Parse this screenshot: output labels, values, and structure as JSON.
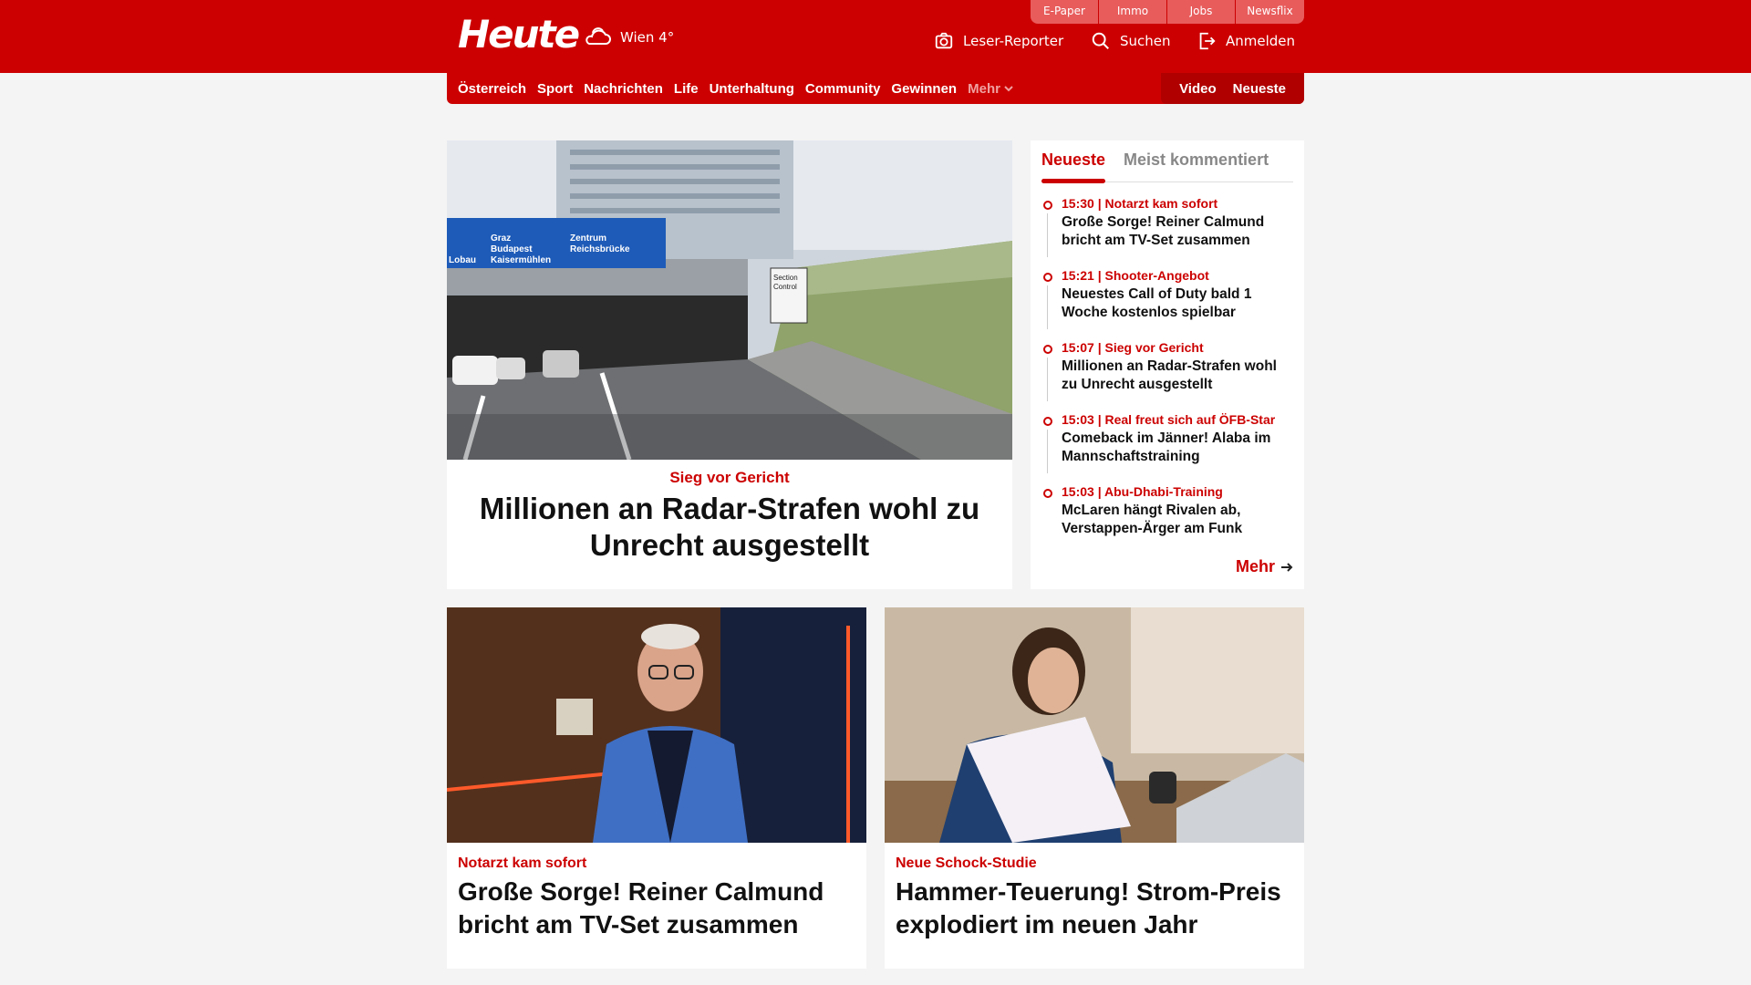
{
  "header": {
    "logo": "Heute",
    "weather": "Wien 4°",
    "top_links": [
      "E-Paper",
      "Immo",
      "Jobs",
      "Newsflix"
    ],
    "tools": {
      "reporter": "Leser-Reporter",
      "search": "Suchen",
      "login": "Anmelden"
    }
  },
  "nav": {
    "items": [
      "Österreich",
      "Sport",
      "Nachrichten",
      "Life",
      "Unterhaltung",
      "Community",
      "Gewinnen"
    ],
    "more": "Mehr",
    "right": [
      "Video",
      "Neueste"
    ]
  },
  "hero": {
    "kicker": "Sieg vor Gericht",
    "title": "Millionen an Radar-Strafen wohl zu Unrecht ausgestellt",
    "image_signs": {
      "left": "Lobau",
      "graz": "Graz",
      "budapest": "Budapest",
      "kaiser": "Kaisermühlen",
      "zentrum": "Zentrum",
      "reichs": "Reichsbrücke",
      "section1": "Section",
      "section2": "Control"
    }
  },
  "sidebar": {
    "tabs": [
      "Neueste",
      "Meist kommentiert"
    ],
    "items": [
      {
        "meta": "15:30 | Notarzt kam sofort",
        "title": "Große Sorge! Reiner Calmund bricht am TV-Set zusammen"
      },
      {
        "meta": "15:21 | Shooter-Angebot",
        "title": "Neuestes Call of Duty bald 1 Woche kostenlos spielbar"
      },
      {
        "meta": "15:07 | Sieg vor Gericht",
        "title": "Millionen an Radar-Strafen wohl zu Unrecht ausgestellt"
      },
      {
        "meta": "15:03 | Real freut sich auf ÖFB-Star",
        "title": "Comeback im Jänner! Alaba im Mannschaftstraining"
      },
      {
        "meta": "15:03 | Abu-Dhabi-Training",
        "title": "McLaren hängt Rivalen ab, Verstappen-Ärger am Funk"
      }
    ],
    "more": "Mehr"
  },
  "cards": [
    {
      "kicker": "Notarzt kam sofort",
      "title": "Große Sorge! Reiner Calmund bricht am TV-Set zusammen"
    },
    {
      "kicker": "Neue Schock-Studie",
      "title": "Hammer-Teuerung! Strom-Preis explodiert im neuen Jahr"
    }
  ],
  "colors": {
    "brand": "#cc0000",
    "background": "#f4f4f4"
  }
}
